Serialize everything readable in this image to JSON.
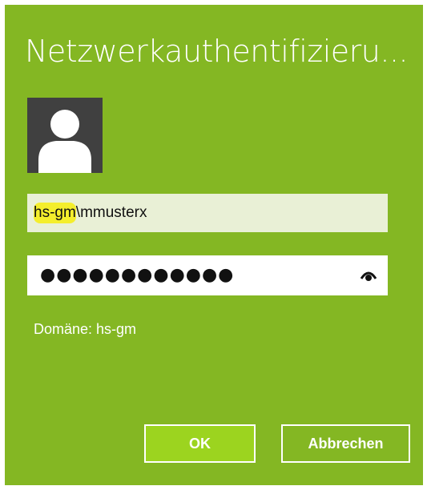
{
  "dialog": {
    "title": "Netzwerkauthentifizieru...",
    "accent_color": "#84b723",
    "avatar_icon": "user-silhouette-icon"
  },
  "username": {
    "prefix": "hs-gm",
    "rest": "\\mmusterx",
    "highlight_color": "#f4ee2c"
  },
  "password": {
    "masked_value": "●●●●●●●●●●●●",
    "reveal_icon": "eye-icon"
  },
  "domain_label": "Domäne: hs-gm",
  "buttons": {
    "ok": "OK",
    "cancel": "Abbrechen"
  }
}
